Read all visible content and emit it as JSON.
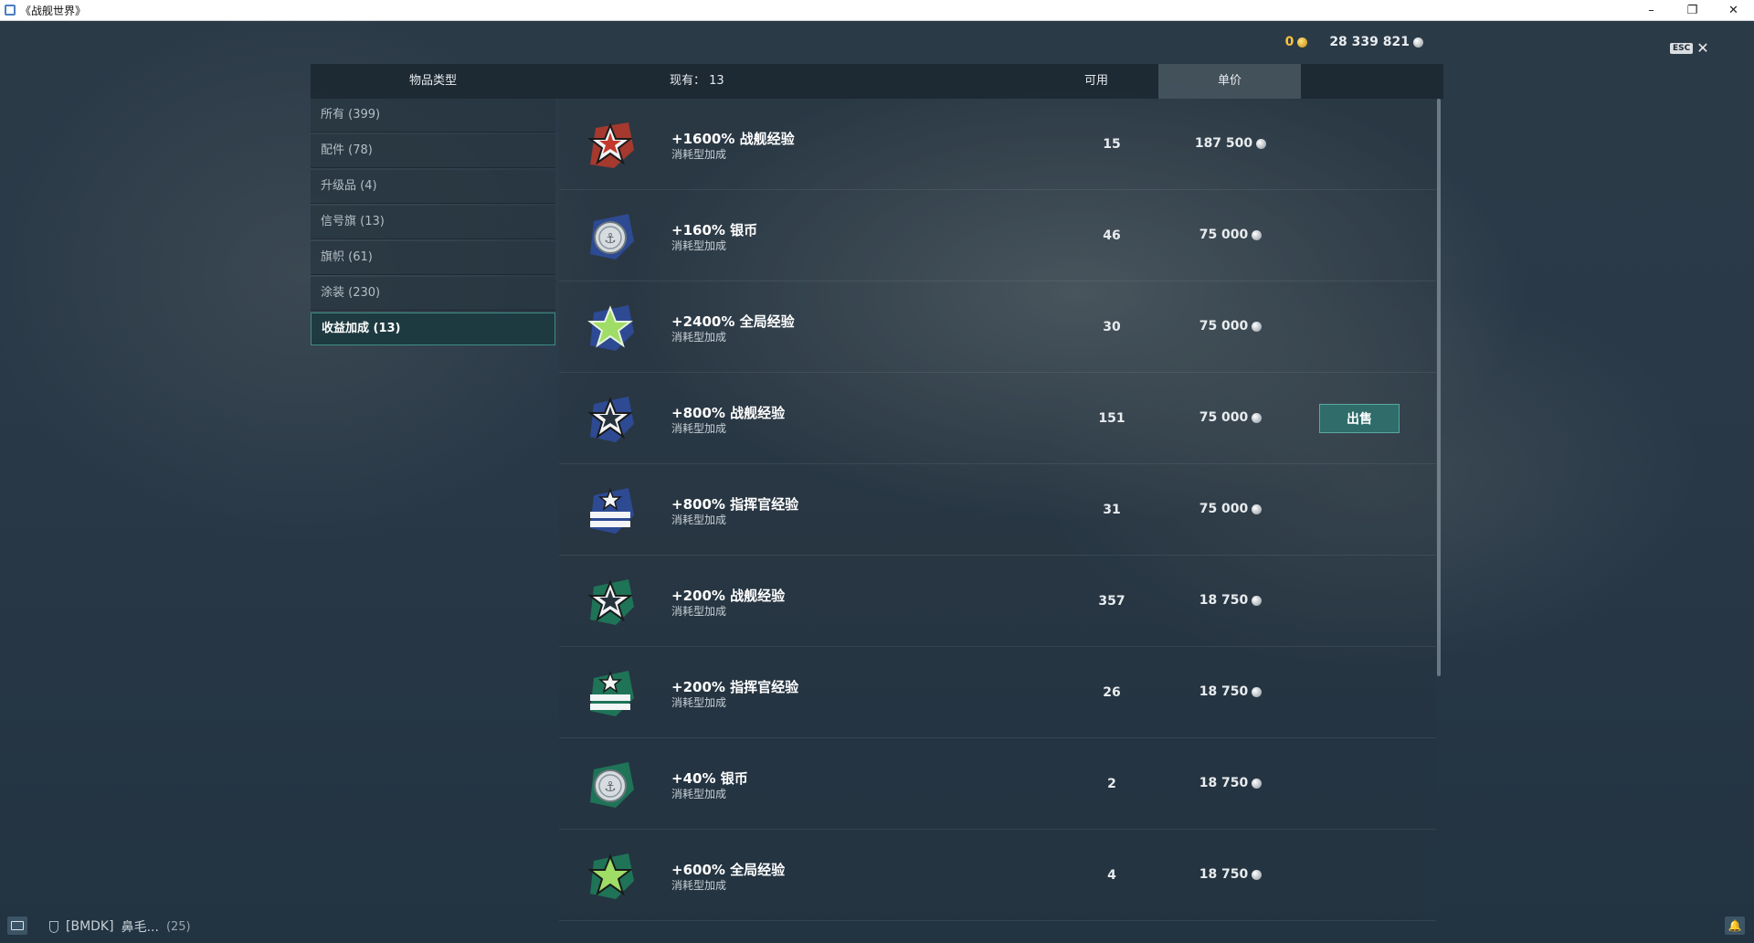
{
  "window": {
    "title": "《战舰世界》"
  },
  "currency": {
    "gold": "0",
    "silver": "28 339 821"
  },
  "esc_label": "ESC",
  "header": {
    "item_type": "物品类型",
    "count_label": "现有：",
    "count_value": "13",
    "available": "可用",
    "unit_price": "单价"
  },
  "sidebar": {
    "items": [
      {
        "label": "所有 (399)"
      },
      {
        "label": "配件 (78)"
      },
      {
        "label": "升级品 (4)"
      },
      {
        "label": "信号旗 (13)"
      },
      {
        "label": "旗帜 (61)"
      },
      {
        "label": "涂装 (230)"
      },
      {
        "label": "收益加成 (13)",
        "active": true
      }
    ]
  },
  "items": [
    {
      "name": "+1600% 战舰经验",
      "sub": "消耗型加成",
      "available": "15",
      "price": "187 500",
      "icon": "star-icon-red"
    },
    {
      "name": "+160% 银币",
      "sub": "消耗型加成",
      "available": "46",
      "price": "75 000",
      "icon": "silver-coin-icon-blue"
    },
    {
      "name": "+2400% 全局经验",
      "sub": "消耗型加成",
      "available": "30",
      "price": "75 000",
      "icon": "green-star-icon-blue"
    },
    {
      "name": "+800% 战舰经验",
      "sub": "消耗型加成",
      "available": "151",
      "price": "75 000",
      "icon": "star-icon-blue",
      "sell": "出售"
    },
    {
      "name": "+800% 指挥官经验",
      "sub": "消耗型加成",
      "available": "31",
      "price": "75 000",
      "icon": "commander-icon-blue"
    },
    {
      "name": "+200% 战舰经验",
      "sub": "消耗型加成",
      "available": "357",
      "price": "18 750",
      "icon": "star-icon-green"
    },
    {
      "name": "+200% 指挥官经验",
      "sub": "消耗型加成",
      "available": "26",
      "price": "18 750",
      "icon": "commander-icon-green"
    },
    {
      "name": "+40% 银币",
      "sub": "消耗型加成",
      "available": "2",
      "price": "18 750",
      "icon": "silver-coin-icon-green"
    },
    {
      "name": "+600% 全局经验",
      "sub": "消耗型加成",
      "available": "4",
      "price": "18 750",
      "icon": "green-star-icon-green"
    }
  ],
  "bottom": {
    "clan": "[BMDK]",
    "player": "鼻毛...",
    "count": "(25)"
  },
  "colors": {
    "accent_teal": "#3f8d86",
    "gold": "#ffc43a",
    "background": "#2a3947"
  }
}
